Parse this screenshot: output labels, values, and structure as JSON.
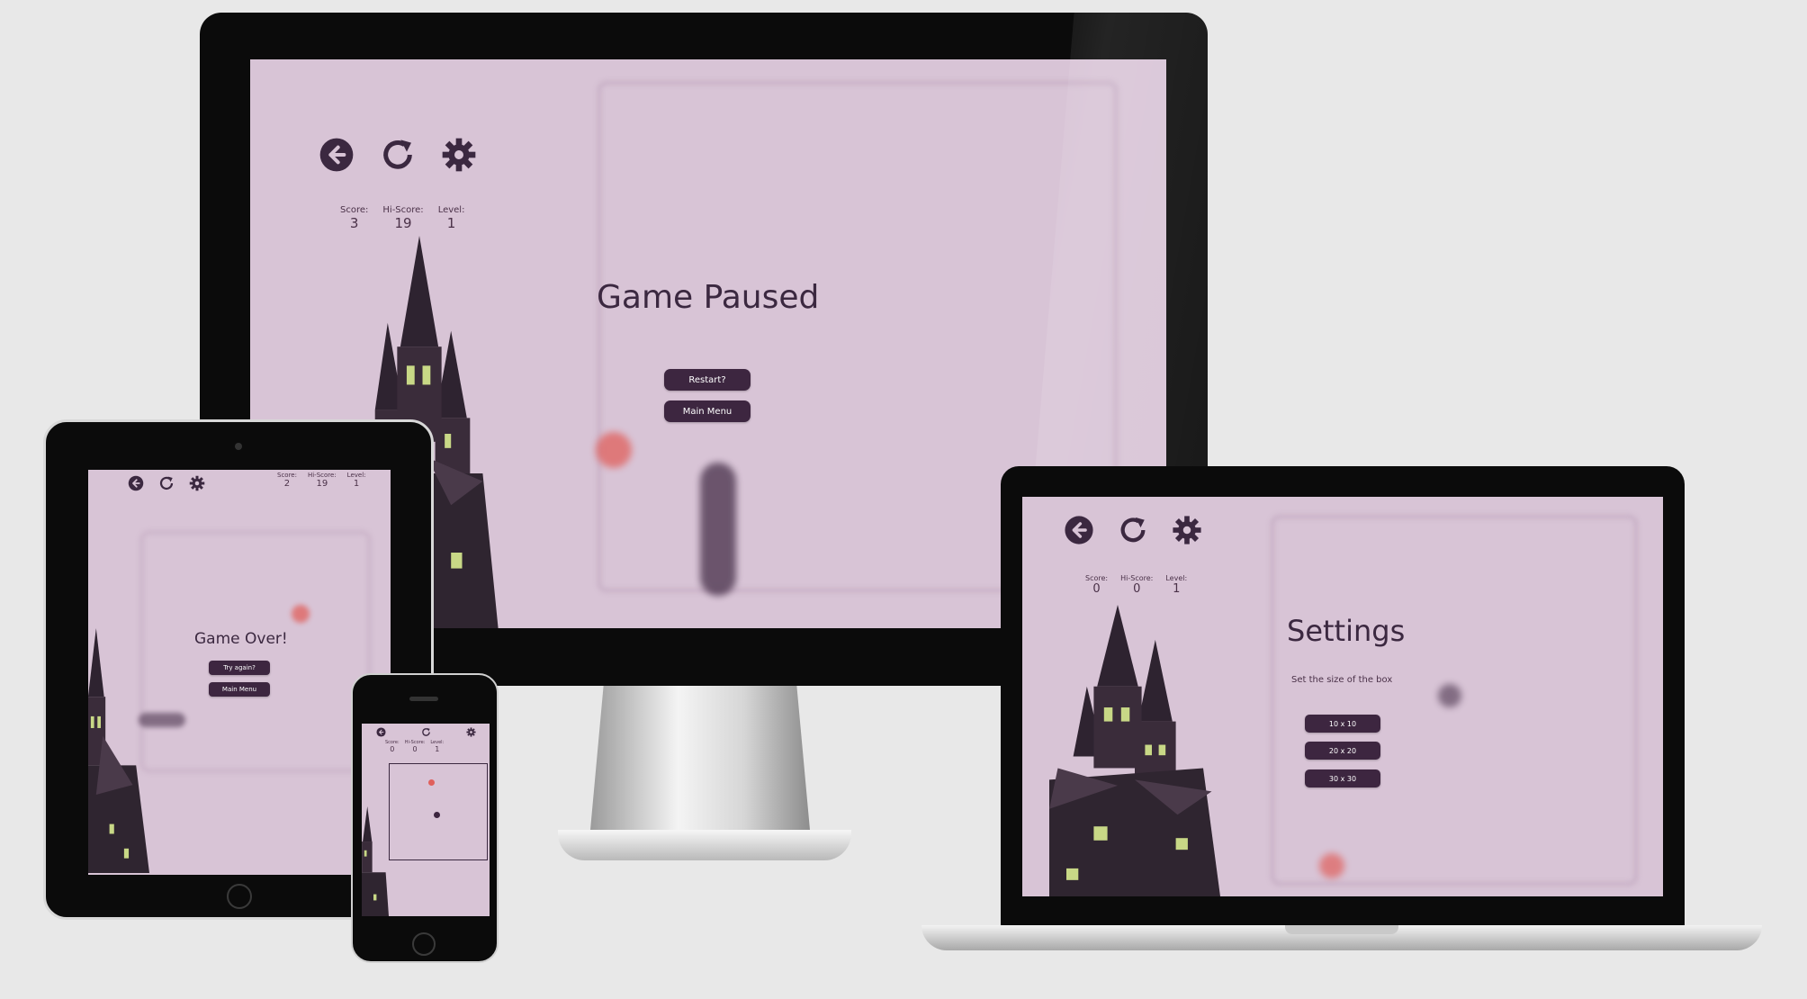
{
  "palette": {
    "screen_bg": "#d8c4d6",
    "ink": "#3b2840",
    "button_bg": "#3d2640",
    "blob_red": "#e0605c"
  },
  "icons": {
    "back": "arrow-left-circle-icon",
    "restart": "rotate-cw-icon",
    "settings": "gear-icon"
  },
  "desktop": {
    "stats": [
      {
        "label": "Score:",
        "value": "3"
      },
      {
        "label": "Hi-Score:",
        "value": "19"
      },
      {
        "label": "Level:",
        "value": "1"
      }
    ],
    "heading": "Game Paused",
    "buttons": [
      "Restart?",
      "Main Menu"
    ]
  },
  "tablet": {
    "stats": [
      {
        "label": "Score:",
        "value": "2"
      },
      {
        "label": "Hi-Score:",
        "value": "19"
      },
      {
        "label": "Level:",
        "value": "1"
      }
    ],
    "heading": "Game Over!",
    "buttons": [
      "Try again?",
      "Main Menu"
    ]
  },
  "phone": {
    "stats": [
      {
        "label": "Score:",
        "value": "0"
      },
      {
        "label": "Hi-Score:",
        "value": "0"
      },
      {
        "label": "Level:",
        "value": "1"
      }
    ]
  },
  "laptop": {
    "stats": [
      {
        "label": "Score:",
        "value": "0"
      },
      {
        "label": "Hi-Score:",
        "value": "0"
      },
      {
        "label": "Level:",
        "value": "1"
      }
    ],
    "heading": "Settings",
    "subtitle": "Set the size of the box",
    "buttons": [
      "10 x 10",
      "20 x 20",
      "30 x 30"
    ]
  }
}
